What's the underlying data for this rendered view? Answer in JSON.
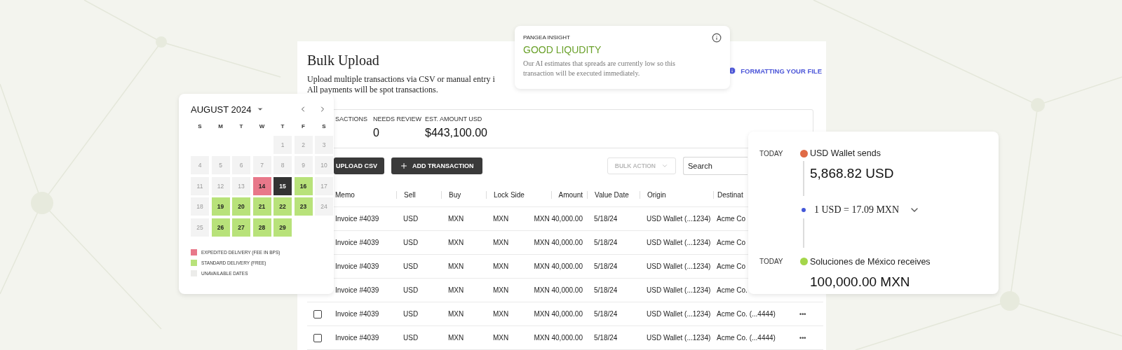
{
  "bulk_upload": {
    "title": "Bulk Upload",
    "description_lines": [
      "Upload multiple transactions via CSV or manual entry i",
      "All payments will be spot transactions."
    ],
    "formatting_link": "FORMATTING YOUR FILE",
    "stats": [
      {
        "label": "SACTIONS"
      },
      {
        "label": "NEEDS REVIEW",
        "value": "0"
      },
      {
        "label": "EST. AMOUNT USD",
        "value": "$443,100.00"
      }
    ],
    "upload_button": "UPLOAD CSV",
    "add_button": "ADD TRANSACTION",
    "bulk_action": {
      "label": "BULK ACTION",
      "disabled": true
    },
    "search": {
      "placeholder": "Search"
    },
    "table": {
      "columns": [
        "Memo",
        "Sell",
        "Buy",
        "Lock Side",
        "Amount",
        "Value Date",
        "Origin",
        "Destinat"
      ],
      "rows": [
        {
          "cells": [
            "Invoice #4039",
            "USD",
            "MXN",
            "MXN",
            "MXN 40,000.00",
            "5/18/24",
            "USD Wallet (...1234)",
            "Acme Co"
          ]
        },
        {
          "cells": [
            "Invoice #4039",
            "USD",
            "MXN",
            "MXN",
            "MXN 40,000.00",
            "5/18/24",
            "USD Wallet (...1234)",
            "Acme Co"
          ]
        },
        {
          "cells": [
            "Invoice #4039",
            "USD",
            "MXN",
            "MXN",
            "MXN 40,000.00",
            "5/18/24",
            "USD Wallet (...1234)",
            "Acme Co"
          ]
        },
        {
          "cells": [
            "Invoice #4039",
            "USD",
            "MXN",
            "MXN",
            "MXN 40,000.00",
            "5/18/24",
            "USD Wallet (...1234)",
            "Acme Co."
          ]
        },
        {
          "checked": false,
          "more": "•••",
          "cells": [
            "Invoice #4039",
            "USD",
            "MXN",
            "MXN",
            "MXN 40,000.00",
            "5/18/24",
            "USD Wallet (...1234)",
            "Acme Co. (...4444)"
          ]
        },
        {
          "checked": false,
          "more": "•••",
          "cells": [
            "Invoice #4039",
            "USD",
            "MXN",
            "MXN",
            "MXN 40,000.00",
            "5/18/24",
            "USD Wallet (...1234)",
            "Acme Co. (...4444)"
          ]
        }
      ]
    }
  },
  "calendar": {
    "month": "AUGUST 2024",
    "weekdays": [
      "S",
      "M",
      "T",
      "W",
      "T",
      "F",
      "S"
    ],
    "weeks": [
      [
        {
          "kind": "empty"
        },
        {
          "kind": "empty"
        },
        {
          "kind": "empty"
        },
        {
          "kind": "empty"
        },
        {
          "day": "1",
          "kind": "unavailable"
        },
        {
          "day": "2",
          "kind": "unavailable"
        },
        {
          "day": "3",
          "kind": "unavailable"
        }
      ],
      [
        {
          "day": "4",
          "kind": "unavailable"
        },
        {
          "day": "5",
          "kind": "unavailable"
        },
        {
          "day": "6",
          "kind": "unavailable"
        },
        {
          "day": "7",
          "kind": "unavailable"
        },
        {
          "day": "8",
          "kind": "unavailable"
        },
        {
          "day": "9",
          "kind": "unavailable"
        },
        {
          "day": "10",
          "kind": "unavailable"
        }
      ],
      [
        {
          "day": "11",
          "kind": "unavailable"
        },
        {
          "day": "12",
          "kind": "unavailable"
        },
        {
          "day": "13",
          "kind": "unavailable"
        },
        {
          "day": "14",
          "kind": "expedited"
        },
        {
          "day": "15",
          "kind": "selected"
        },
        {
          "day": "16",
          "kind": "standard"
        },
        {
          "day": "17",
          "kind": "unavailable"
        }
      ],
      [
        {
          "day": "18",
          "kind": "unavailable"
        },
        {
          "day": "19",
          "kind": "standard"
        },
        {
          "day": "20",
          "kind": "standard"
        },
        {
          "day": "21",
          "kind": "standard"
        },
        {
          "day": "22",
          "kind": "standard"
        },
        {
          "day": "23",
          "kind": "standard"
        },
        {
          "day": "24",
          "kind": "unavailable"
        }
      ],
      [
        {
          "day": "25",
          "kind": "unavailable"
        },
        {
          "day": "26",
          "kind": "standard"
        },
        {
          "day": "27",
          "kind": "standard"
        },
        {
          "day": "28",
          "kind": "standard"
        },
        {
          "day": "29",
          "kind": "standard"
        },
        {
          "kind": "empty"
        },
        {
          "kind": "empty"
        }
      ]
    ],
    "legend": [
      {
        "label": "EXPEDITED DELIVERY (FEE IN BPS)",
        "color": "#e8788a"
      },
      {
        "label": "STANDARD DELIVERY (FREE)",
        "color": "#b8e27a"
      },
      {
        "label": "UNAVAILABLE DATES",
        "color": "#ececea"
      }
    ]
  },
  "insight": {
    "eyebrow": "PANGEA INSIGHT",
    "headline": "GOOD LIQUDITY",
    "body": "Our AI estimates that spreads are currently low so this transaction will be executed immediately."
  },
  "transfer": {
    "send": {
      "when": "TODAY",
      "title": "USD Wallet sends",
      "amount": "5,868.82 USD",
      "color": "#e06a45"
    },
    "rate": {
      "text": "1 USD = 17.09 MXN",
      "color": "#4457d8"
    },
    "receive": {
      "when": "TODAY",
      "title": "Soluciones de México receives",
      "amount": "100,000.00 MXN",
      "color": "#a4d64a"
    }
  }
}
